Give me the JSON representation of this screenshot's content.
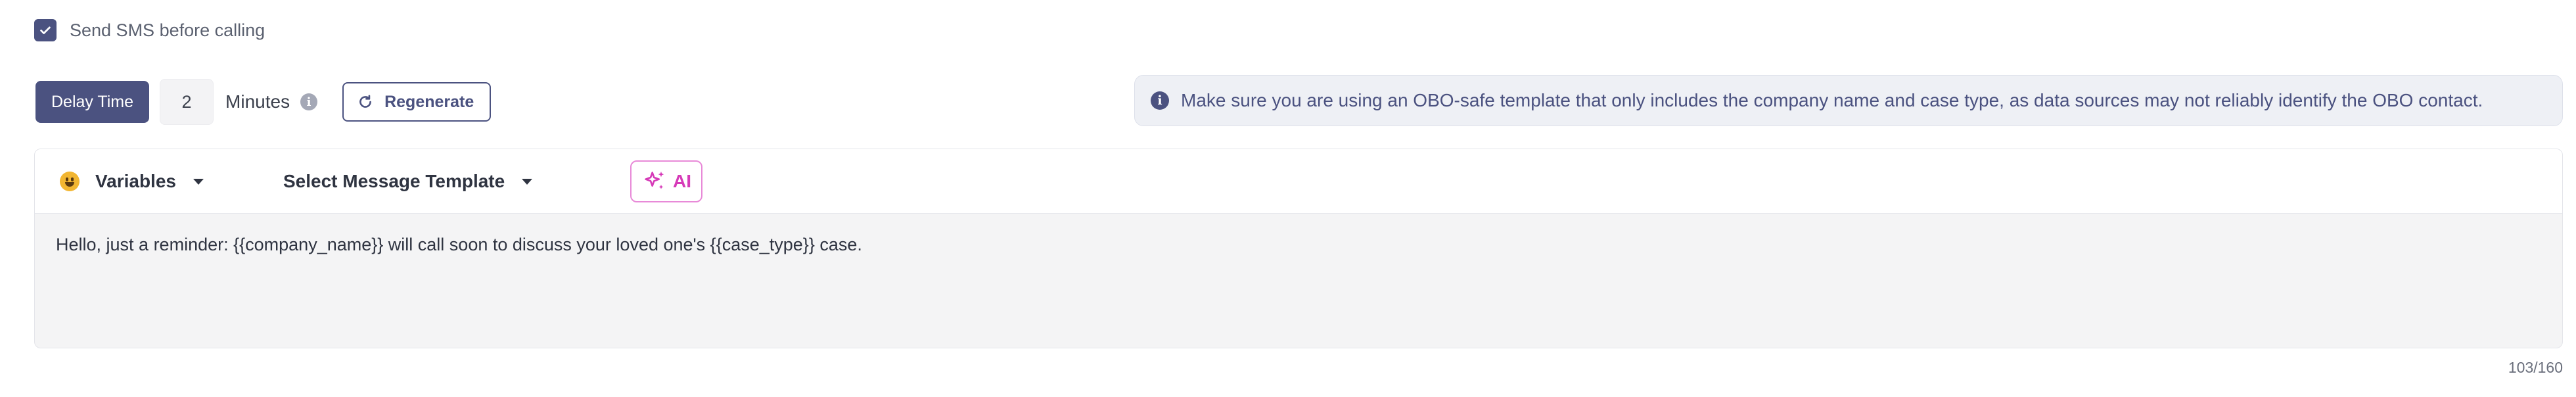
{
  "sms_toggle": {
    "checked": true,
    "label": "Send SMS before calling"
  },
  "delay": {
    "button_label": "Delay Time",
    "value": "2",
    "unit_label": "Minutes",
    "info_icon": "info-icon"
  },
  "regenerate": {
    "label": "Regenerate",
    "icon": "refresh-icon"
  },
  "banner": {
    "icon": "info-icon",
    "text": "Make sure you are using an OBO-safe template that only includes the company name and case type, as data sources may not reliably identify the OBO contact."
  },
  "editor": {
    "toolbar": {
      "variables_label": "Variables",
      "variables_icon": "emoji-icon",
      "template_label": "Select Message Template",
      "ai_label": "AI",
      "ai_icon": "sparkles-icon"
    },
    "message": "Hello, just a reminder: {{company_name}} will call soon to discuss your loved one's {{case_type}} case.",
    "char_count": "103/160"
  },
  "colors": {
    "primary": "#4b5280",
    "ai_accent": "#d63ab8",
    "banner_bg": "#eef0f5",
    "editor_bg": "#f4f4f5"
  }
}
